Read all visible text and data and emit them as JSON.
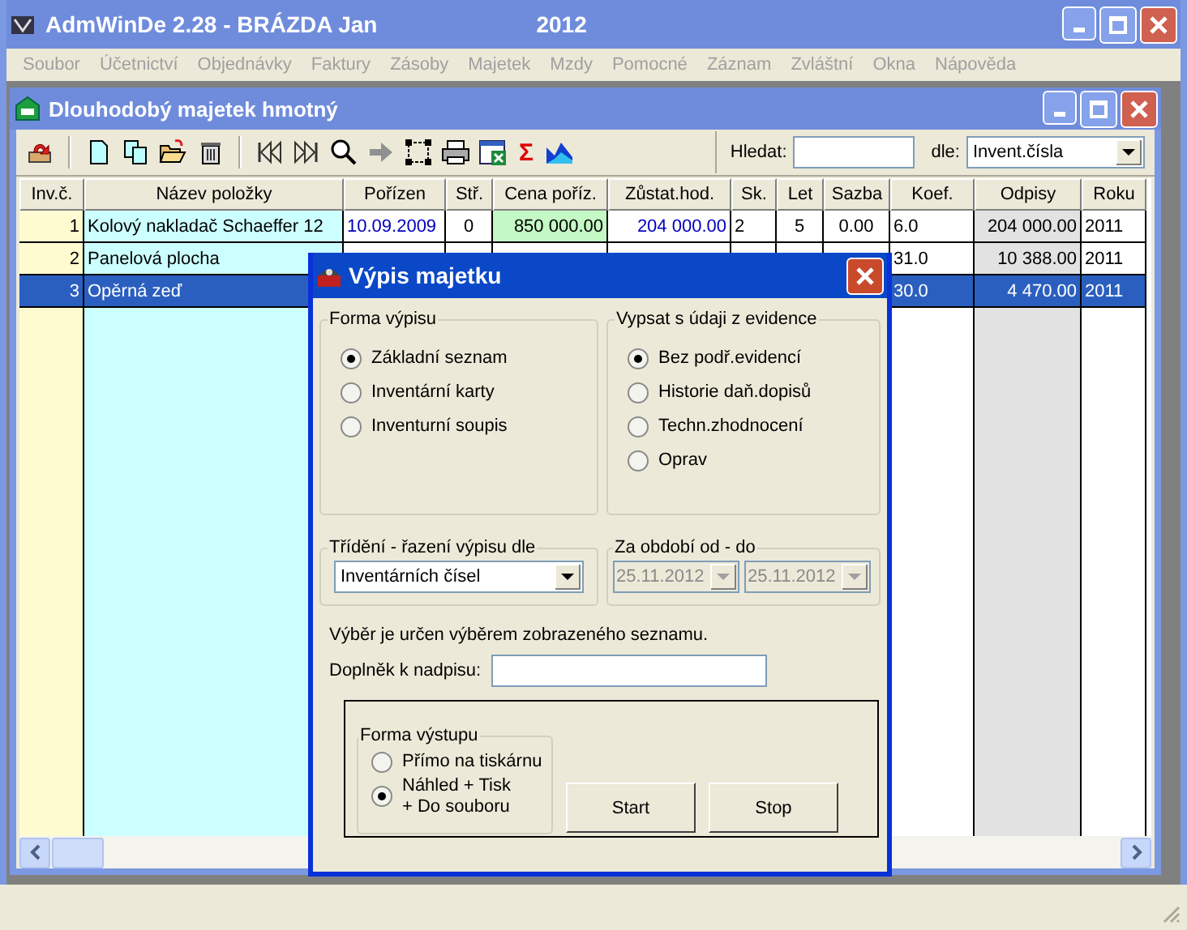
{
  "window": {
    "title": "AdmWinDe 2.28 - BRÁZDA Jan",
    "year": "2012"
  },
  "menu": [
    {
      "label": "Soubor",
      "disabled": true
    },
    {
      "label": "Účetnictví",
      "disabled": true
    },
    {
      "label": "Objednávky",
      "disabled": true
    },
    {
      "label": "Faktury",
      "disabled": true
    },
    {
      "label": "Zásoby",
      "disabled": true
    },
    {
      "label": "Majetek",
      "disabled": true
    },
    {
      "label": "Mzdy",
      "disabled": true
    },
    {
      "label": "Pomocné",
      "disabled": true
    },
    {
      "label": "Záznam",
      "disabled": true
    },
    {
      "label": "Zvláštní",
      "disabled": true
    },
    {
      "label": "Okna",
      "disabled": true
    },
    {
      "label": "Nápověda",
      "disabled": true
    }
  ],
  "child_window": {
    "title": "Dlouhodobý majetek hmotný",
    "toolbar": {
      "sum_button": "Σ",
      "search_label": "Hledat:",
      "by_label": "dle:",
      "by_value": "Invent.čísla"
    },
    "table": {
      "columns": [
        "Inv.č.",
        "Název položky",
        "Pořízen",
        "Stř.",
        "Cena poříz.",
        "Zůstat.hod.",
        "Sk.",
        "Let",
        "Sazba",
        "Koef.",
        "Odpisy",
        "Roku"
      ],
      "rows": [
        {
          "selected": false,
          "inv": "1",
          "name": "Kolový nakladač Schaeffer 12",
          "acquired": "10.09.2009",
          "center": "0",
          "price": "850 000.00",
          "residual": "204 000.00",
          "group": "2",
          "years": "5",
          "rate": "0.00",
          "coef": "6.0",
          "depreciation": "204 000.00",
          "year": "2011"
        },
        {
          "selected": false,
          "inv": "2",
          "name": "Panelová plocha",
          "coef": "31.0",
          "depreciation": "10 388.00",
          "year": "2011"
        },
        {
          "selected": true,
          "inv": "3",
          "name": "Opěrná zeď",
          "coef": "30.0",
          "depreciation": "4 470.00",
          "year": "2011"
        }
      ]
    }
  },
  "dialog": {
    "title": "Výpis majetku",
    "form_group": {
      "title": "Forma výpisu",
      "options": [
        {
          "label": "Základní seznam",
          "selected": true
        },
        {
          "label": "Inventární karty",
          "selected": false
        },
        {
          "label": "Inventurní soupis",
          "selected": false
        }
      ]
    },
    "evidence_group": {
      "title": "Vypsat s údaji z evidence",
      "options": [
        {
          "label": "Bez podř.evidencí",
          "selected": true
        },
        {
          "label": "Historie daň.dopisů",
          "selected": false
        },
        {
          "label": "Techn.zhodnocení",
          "selected": false
        },
        {
          "label": "Oprav",
          "selected": false
        }
      ]
    },
    "sort_group": {
      "title": "Třídění - řazení výpisu dle",
      "value": "Inventárních čísel"
    },
    "period_group": {
      "title": "Za období od - do",
      "from": {
        "value": "25.11.2012",
        "disabled": true
      },
      "to": {
        "value": "25.11.2012",
        "disabled": true
      }
    },
    "note": "Výběr je určen výběrem zobrazeného seznamu.",
    "heading_label": "Doplněk k nadpisu:",
    "output_group": {
      "title": "Forma výstupu",
      "options": [
        {
          "label": "Přímo na tiskárnu",
          "selected": false
        },
        {
          "label": "Náhled + Tisk\n+ Do souboru",
          "selected": true
        }
      ]
    },
    "buttons": [
      "Start",
      "Stop"
    ]
  }
}
